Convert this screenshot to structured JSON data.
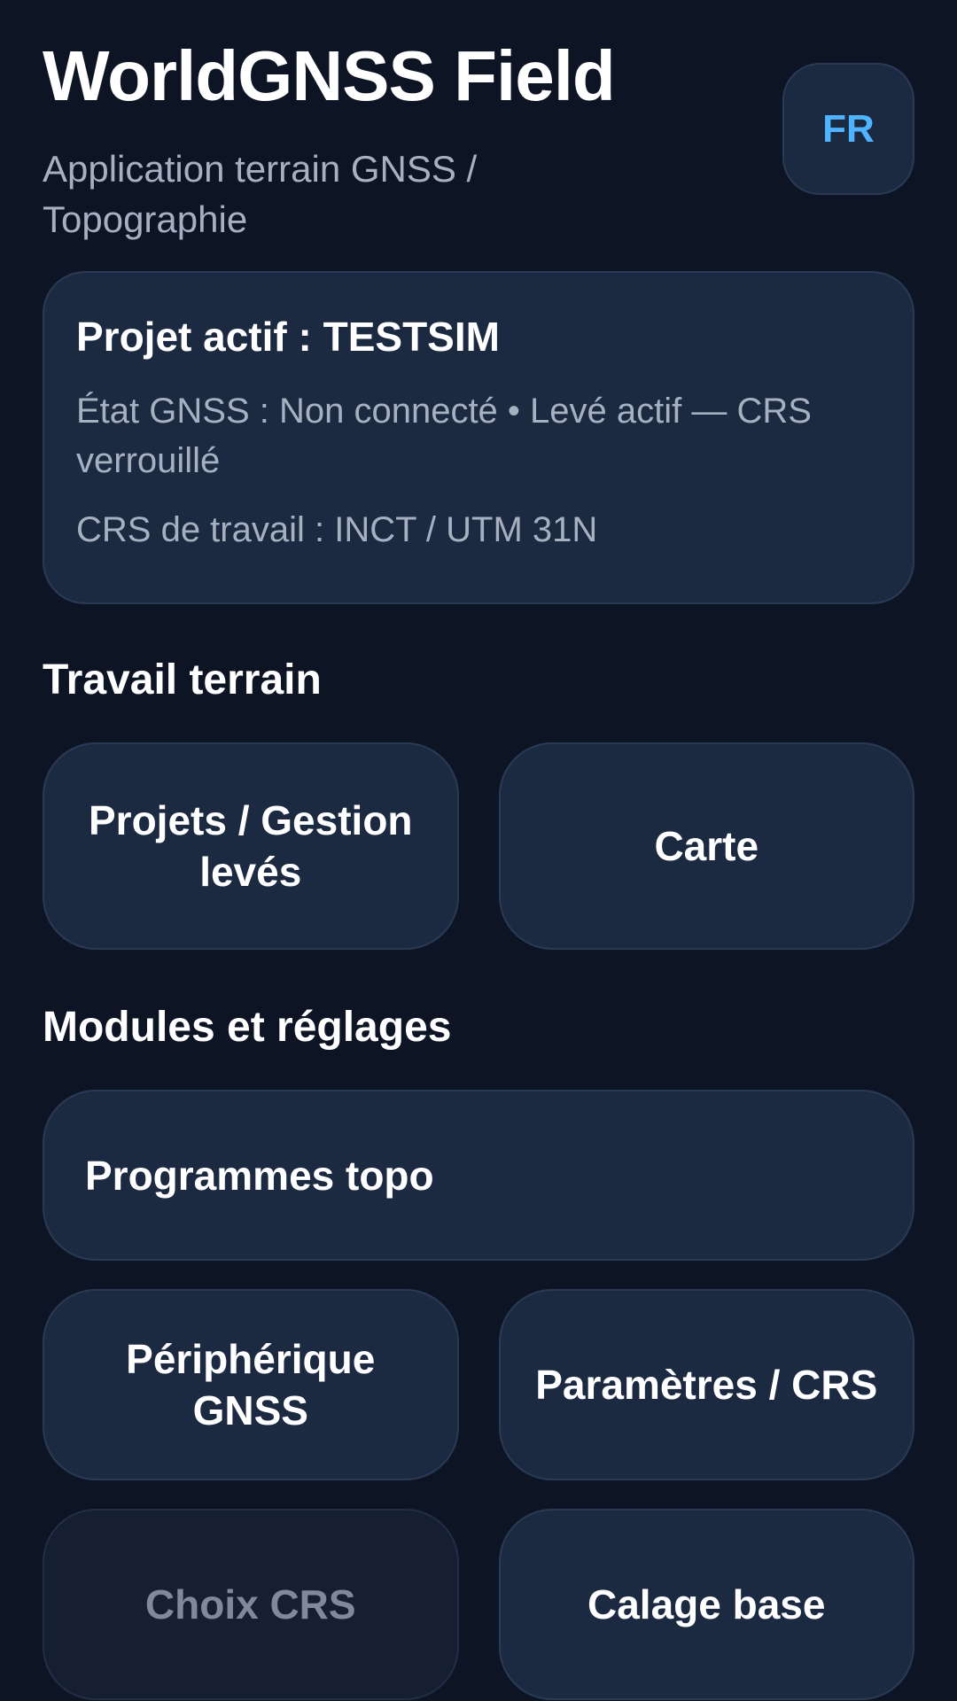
{
  "header": {
    "title": "WorldGNSS Field",
    "subtitle": "Application terrain GNSS / Topographie",
    "language_button": "FR"
  },
  "project_card": {
    "name": "Projet actif : TESTSIM",
    "state": "État GNSS : Non connecté • Levé actif — CRS verrouillé",
    "crs": "CRS de travail : INCT / UTM 31N"
  },
  "sections": {
    "terrain": {
      "title": "Travail terrain",
      "buttons": [
        "Projets / Gestion levés",
        "Carte"
      ]
    },
    "modules": {
      "title": "Modules et réglages",
      "buttons": [
        "Programmes topo",
        "Périphérique GNSS",
        "Paramètres / CRS",
        "Choix CRS",
        "Calage base"
      ]
    }
  },
  "colors": {
    "background": "#0d1525",
    "card": "#1c2a41",
    "accent": "#4fb3ff",
    "muted_text": "#a6b0c0",
    "disabled_text": "#7f8999"
  }
}
